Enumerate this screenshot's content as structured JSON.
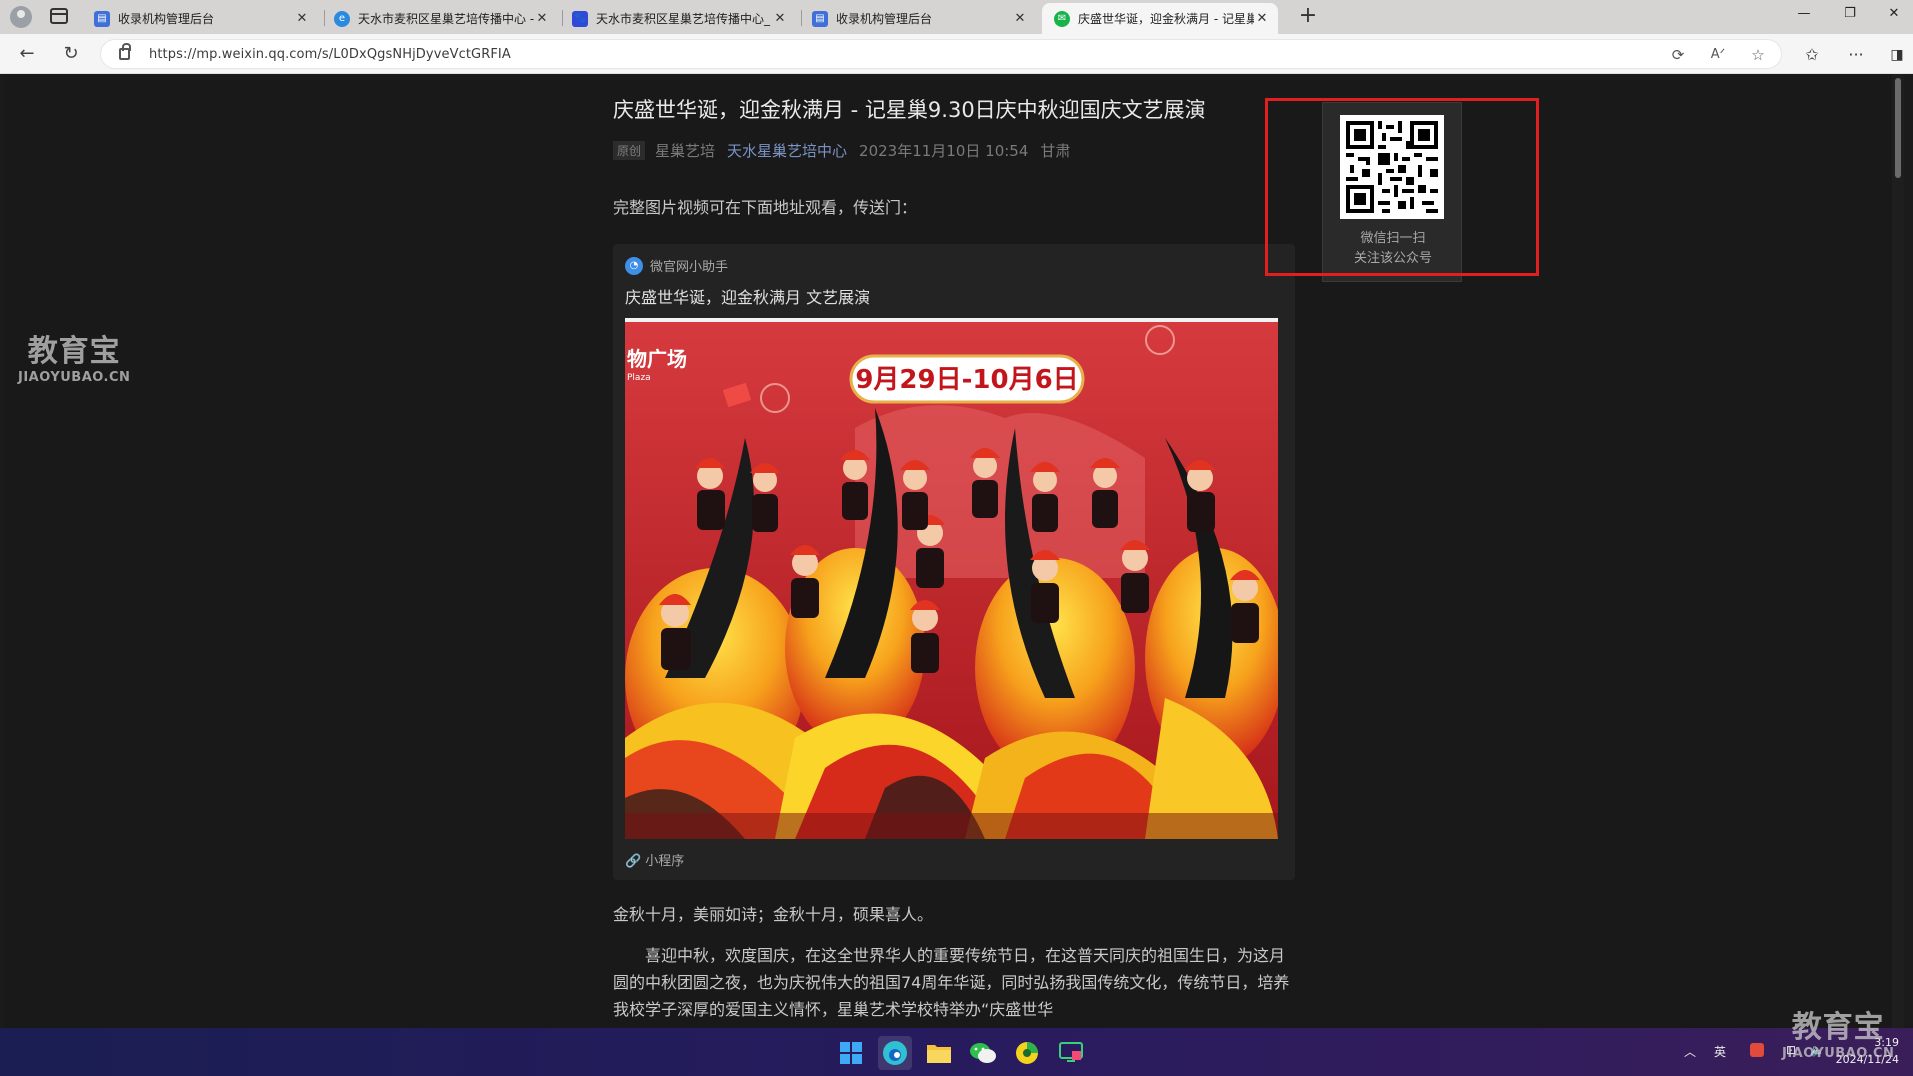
{
  "tabs": [
    {
      "title": "收录机构管理后台",
      "favicon": "admin-favicon",
      "color": "#3f6fd8",
      "active": false
    },
    {
      "title": "天水市麦积区星巢艺培传播中心 -",
      "favicon": "edge-favicon",
      "color": "#2a8ae0",
      "active": false
    },
    {
      "title": "天水市麦积区星巢艺培传播中心_",
      "favicon": "baidu-favicon",
      "color": "#3049d8",
      "active": false
    },
    {
      "title": "收录机构管理后台",
      "favicon": "admin-favicon",
      "color": "#3f6fd8",
      "active": false
    },
    {
      "title": "庆盛世华诞，迎金秋满月 - 记星巢",
      "favicon": "wechat-favicon",
      "color": "#19b34c",
      "active": true
    }
  ],
  "address": {
    "url": "https://mp.weixin.qq.com/s/L0DxQgsNHjDyveVctGRFIA"
  },
  "article": {
    "title": "庆盛世华诞，迎金秋满月 - 记星巢9.30日庆中秋迎国庆文艺展演",
    "original_tag": "原创",
    "author": "星巢艺培",
    "account": "天水星巢艺培中心",
    "date": "2023年11月10日 10:54",
    "location": "甘肃",
    "intro": "完整图片视频可在下面地址观看，传送门：",
    "card": {
      "source": "微官网小助手",
      "title": "庆盛世华诞，迎金秋满月 文艺展演",
      "footer": "小程序",
      "image_banner": "9月29日-10月6日",
      "image_side_text": "物广场",
      "image_side_sub": "Plaza"
    },
    "para1": "金秋十月，美丽如诗；金秋十月，硕果喜人。",
    "para2": "喜迎中秋，欢度国庆，在这全世界华人的重要传统节日，在这普天同庆的祖国生日，为这月圆的中秋团圆之夜，也为庆祝伟大的祖国74周年华诞，同时弘扬我国传统文化，传统节日，培养我校学子深厚的爱国主义情怀，星巢艺术学校特举办“庆盛世华"
  },
  "qr": {
    "line1": "微信扫一扫",
    "line2": "关注该公众号"
  },
  "watermark": {
    "cn": "教育宝",
    "en": "JIAOYUBAO.CN"
  },
  "taskbar": {
    "ime": "英",
    "time": "3:19",
    "date": "2024/11/24"
  }
}
